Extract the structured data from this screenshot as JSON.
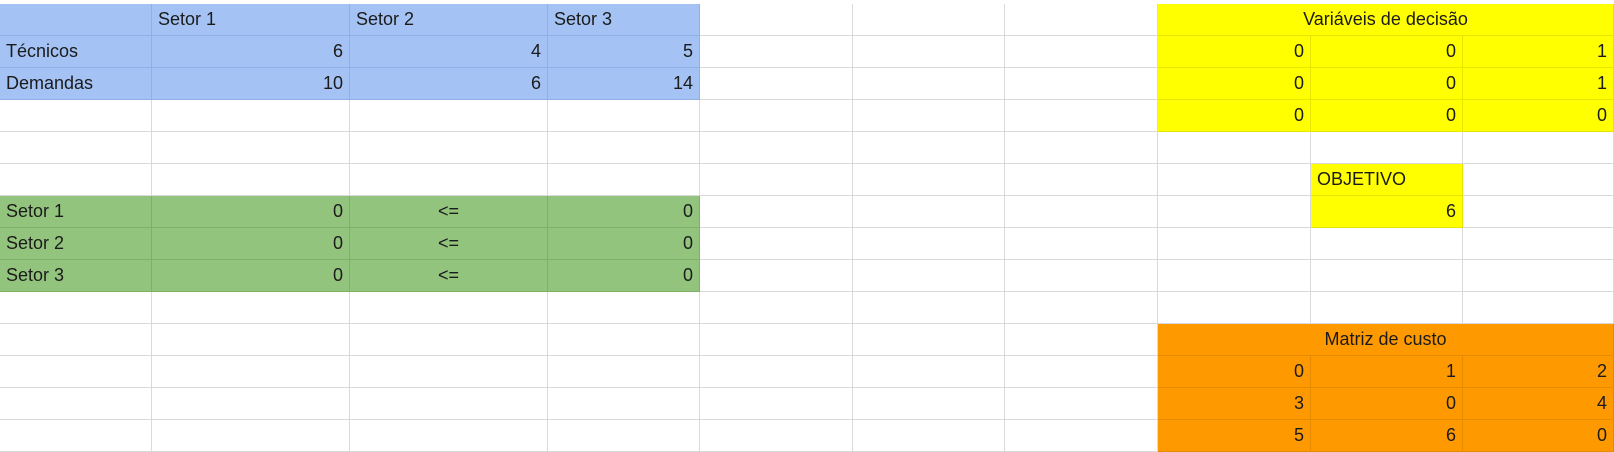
{
  "colors": {
    "blue": "#a4c2f4",
    "green": "#93c47d",
    "yellow": "#ffff00",
    "orange": "#ff9900",
    "gridline": "#d9d9d9"
  },
  "sectors_table": {
    "header": [
      "",
      "Setor 1",
      "Setor 2",
      "Setor 3"
    ],
    "rows": [
      [
        "Técnicos",
        "6",
        "4",
        "5"
      ],
      [
        "Demandas",
        "10",
        "6",
        "14"
      ]
    ]
  },
  "constraints_table": {
    "rows": [
      [
        "Setor 1",
        "0",
        "<=",
        "0"
      ],
      [
        "Setor 2",
        "0",
        "<=",
        "0"
      ],
      [
        "Setor 3",
        "0",
        "<=",
        "0"
      ]
    ]
  },
  "decision_variables": {
    "title": "Variáveis de decisão",
    "matrix": [
      [
        "0",
        "0",
        "1"
      ],
      [
        "0",
        "0",
        "1"
      ],
      [
        "0",
        "0",
        "0"
      ]
    ]
  },
  "objective": {
    "label": "OBJETIVO",
    "value": "6"
  },
  "cost_matrix": {
    "title": "Matriz de custo",
    "matrix": [
      [
        "0",
        "1",
        "2"
      ],
      [
        "3",
        "0",
        "4"
      ],
      [
        "5",
        "6",
        "0"
      ]
    ]
  }
}
